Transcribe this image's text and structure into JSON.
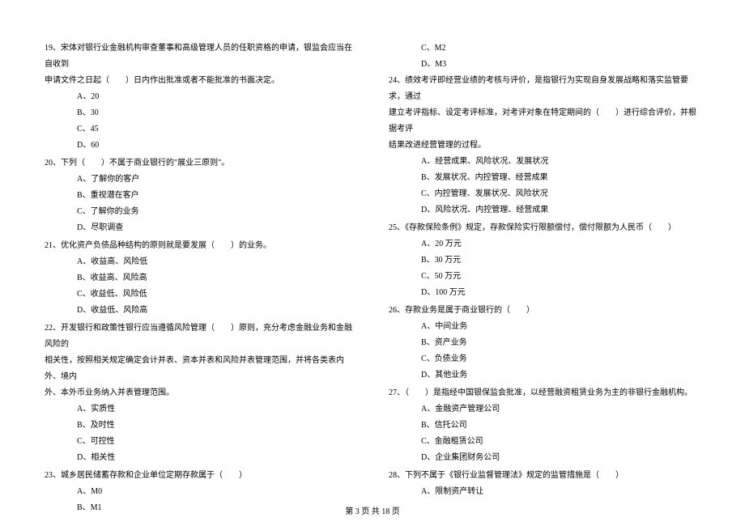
{
  "left": {
    "q19": {
      "text": "19、宋体对银行业金融机构审查董事和高级管理人员的任职资格的申请，银监会应当在自收到",
      "cont": "申请文件之日起（　　）日内作出批准或者不能批准的书面决定。",
      "a": "A、20",
      "b": "B、30",
      "c": "C、45",
      "d": "D、60"
    },
    "q20": {
      "text": "20、下列（　　）不属于商业银行的\"展业三原则\"。",
      "a": "A、了解你的客户",
      "b": "B、重视潜在客户",
      "c": "C、了解你的业务",
      "d": "D、尽职调查"
    },
    "q21": {
      "text": "21、优化资产负债品种结构的原则就是要发展（　　）的业务。",
      "a": "A、收益高、风险低",
      "b": "B、收益高、风险高",
      "c": "C、收益低、风险低",
      "d": "D、收益低、风险高"
    },
    "q22": {
      "text": "22、开发银行和政策性银行应当遵循风险管理（　　）原则，充分考虑金融业务和金融风险的",
      "cont1": "相关性，按照相关规定确定会计并表、资本并表和风险并表管理范围，并将各类表内外、境内",
      "cont2": "外、本外币业务纳入并表管理范围。",
      "a": "A、实质性",
      "b": "B、及时性",
      "c": "C、可控性",
      "d": "D、相关性"
    },
    "q23": {
      "text": "23、城乡居民储蓄存款和企业单位定期存款属于（　　）",
      "a": "A、M0",
      "b": "B、M1"
    }
  },
  "right": {
    "q23c": "C、M2",
    "q23d": "D、M3",
    "q24": {
      "text": "24、绩效考评即经营业绩的考核与评价，是指银行为实现自身发展战略和落实监管要求，通过",
      "cont1": "建立考评指标、设定考评标准，对考评对象在特定期间的（　　）进行综合评价，并根据考评",
      "cont2": "结果改进经营管理的过程。",
      "a": "A、经营成果、风险状况、发展状况",
      "b": "B、发展状况、内控管理、经营成果",
      "c": "C、内控管理、发展状况、风险状况",
      "d": "D、风险状况、内控管理、经营成果"
    },
    "q25": {
      "text": "25、《存款保险条例》规定，存款保险实行限额偿付，偿付限额为人民币（　　）",
      "a": "A、20 万元",
      "b": "B、30 万元",
      "c": "C、50 万元",
      "d": "D、100 万元"
    },
    "q26": {
      "text": "26、存款业务是属于商业银行的（　　）",
      "a": "A、中间业务",
      "b": "B、资产业务",
      "c": "C、负债业务",
      "d": "D、其他业务"
    },
    "q27": {
      "text": "27、（　　）是指经中国银保监会批准，以经营融资租赁业务为主的非银行金融机构。",
      "a": "A、金融资产管理公司",
      "b": "B、信托公司",
      "c": "C、金融租赁公司",
      "d": "D、企业集团财务公司"
    },
    "q28": {
      "text": "28、下列不属于《银行业监督管理法》规定的监管措施是（　　）",
      "a": "A、限制资产转让"
    }
  },
  "footer": "第 3 页 共 18 页"
}
